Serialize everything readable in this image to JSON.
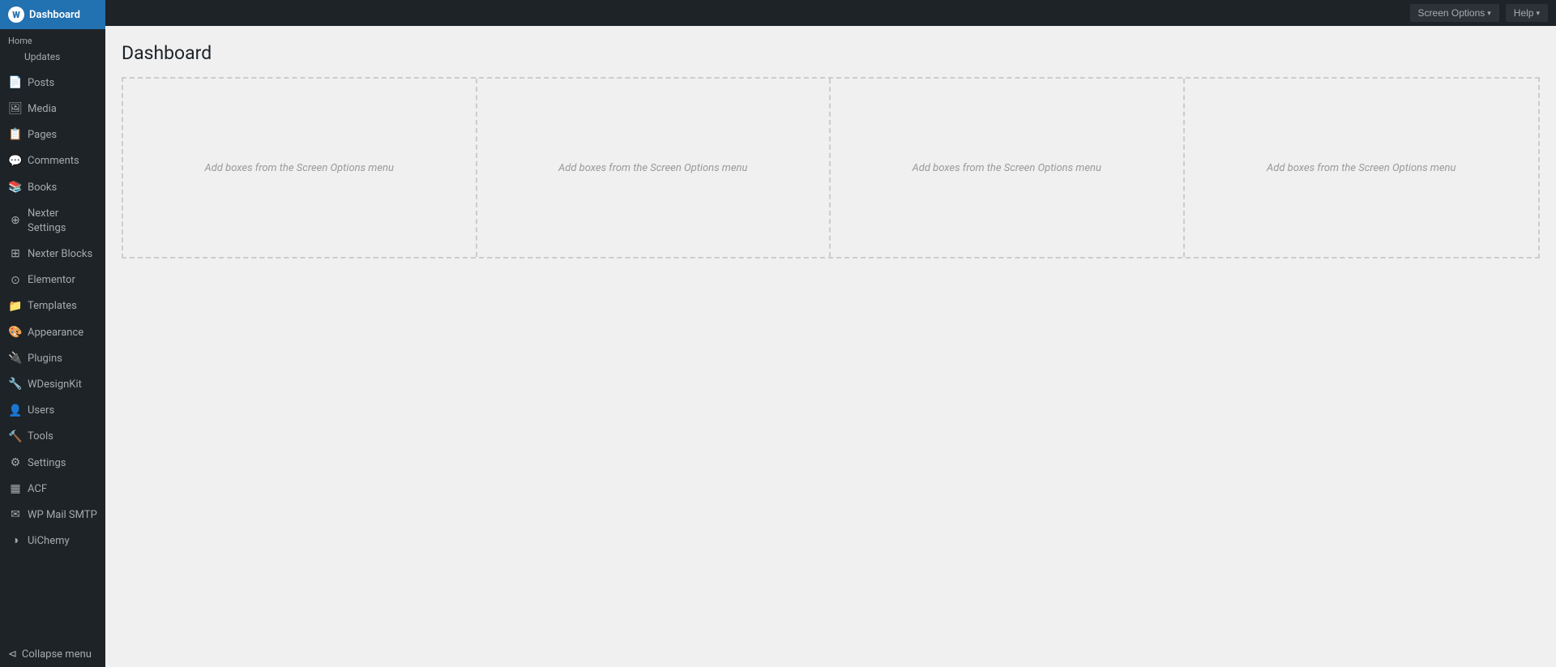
{
  "sidebar": {
    "header": {
      "label": "Dashboard"
    },
    "home_label": "Home",
    "updates_label": "Updates",
    "items": [
      {
        "id": "posts",
        "label": "Posts",
        "icon": "📄"
      },
      {
        "id": "media",
        "label": "Media",
        "icon": "🖼"
      },
      {
        "id": "pages",
        "label": "Pages",
        "icon": "📋"
      },
      {
        "id": "comments",
        "label": "Comments",
        "icon": "💬"
      },
      {
        "id": "books",
        "label": "Books",
        "icon": "📚"
      },
      {
        "id": "nexter-settings",
        "label": "Nexter Settings",
        "icon": "⊕"
      },
      {
        "id": "nexter-blocks",
        "label": "Nexter Blocks",
        "icon": "⊞"
      },
      {
        "id": "elementor",
        "label": "Elementor",
        "icon": "⊙"
      },
      {
        "id": "templates",
        "label": "Templates",
        "icon": "📁"
      },
      {
        "id": "appearance",
        "label": "Appearance",
        "icon": "🎨"
      },
      {
        "id": "plugins",
        "label": "Plugins",
        "icon": "🔌"
      },
      {
        "id": "wdesignkit",
        "label": "WDesignKit",
        "icon": "🔧"
      },
      {
        "id": "users",
        "label": "Users",
        "icon": "👤"
      },
      {
        "id": "tools",
        "label": "Tools",
        "icon": "🔨"
      },
      {
        "id": "settings",
        "label": "Settings",
        "icon": "⚙"
      },
      {
        "id": "acf",
        "label": "ACF",
        "icon": "▦"
      },
      {
        "id": "wp-mail-smtp",
        "label": "WP Mail SMTP",
        "icon": "✉"
      },
      {
        "id": "uichemy",
        "label": "UiChemy",
        "icon": "◑"
      }
    ],
    "collapse_label": "Collapse menu"
  },
  "topbar": {
    "screen_options_label": "Screen Options",
    "help_label": "Help"
  },
  "main": {
    "page_title": "Dashboard",
    "grid_columns": [
      {
        "id": "col1",
        "placeholder": "Add boxes from the Screen Options menu"
      },
      {
        "id": "col2",
        "placeholder": "Add boxes from the Screen Options menu"
      },
      {
        "id": "col3",
        "placeholder": "Add boxes from the Screen Options menu"
      },
      {
        "id": "col4",
        "placeholder": "Add boxes from the Screen Options menu"
      }
    ]
  }
}
